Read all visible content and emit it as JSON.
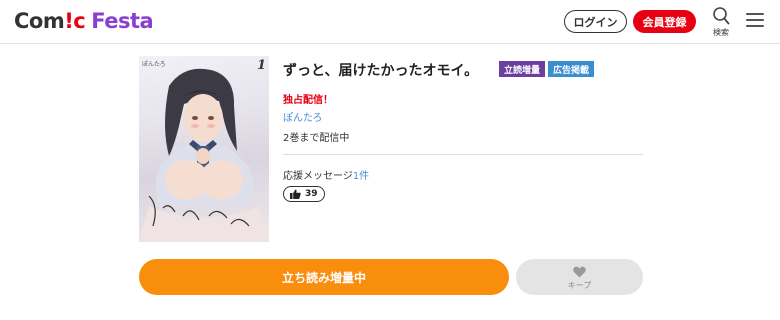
{
  "header": {
    "logo_main": "Com",
    "logo_excl": "!c",
    "logo_sub": "Festa",
    "login_label": "ログイン",
    "register_label": "会員登録",
    "search_label": "検索"
  },
  "book": {
    "title": "ずっと、届けたかったオモイ。",
    "badges": [
      "立読増量",
      "広告掲載"
    ],
    "exclusive": "独占配信！",
    "author": "ぽんたろ",
    "status": "2巻まで配信中",
    "cover_volume": "1",
    "cover_author": "ぽんたろ"
  },
  "cheer": {
    "label": "応援メッセージ",
    "count": "1件"
  },
  "likes": {
    "count": "39"
  },
  "actions": {
    "read_label": "立ち読み増量中",
    "keep_label": "キープ"
  },
  "colors": {
    "brand_purple": "#8a3fd0",
    "register_red": "#e60012",
    "read_orange": "#f98d0c",
    "link_blue": "#4a8fd6"
  },
  "icons": [
    "search-icon",
    "hamburger-menu-icon",
    "thumbs-up-icon",
    "heart-icon"
  ]
}
